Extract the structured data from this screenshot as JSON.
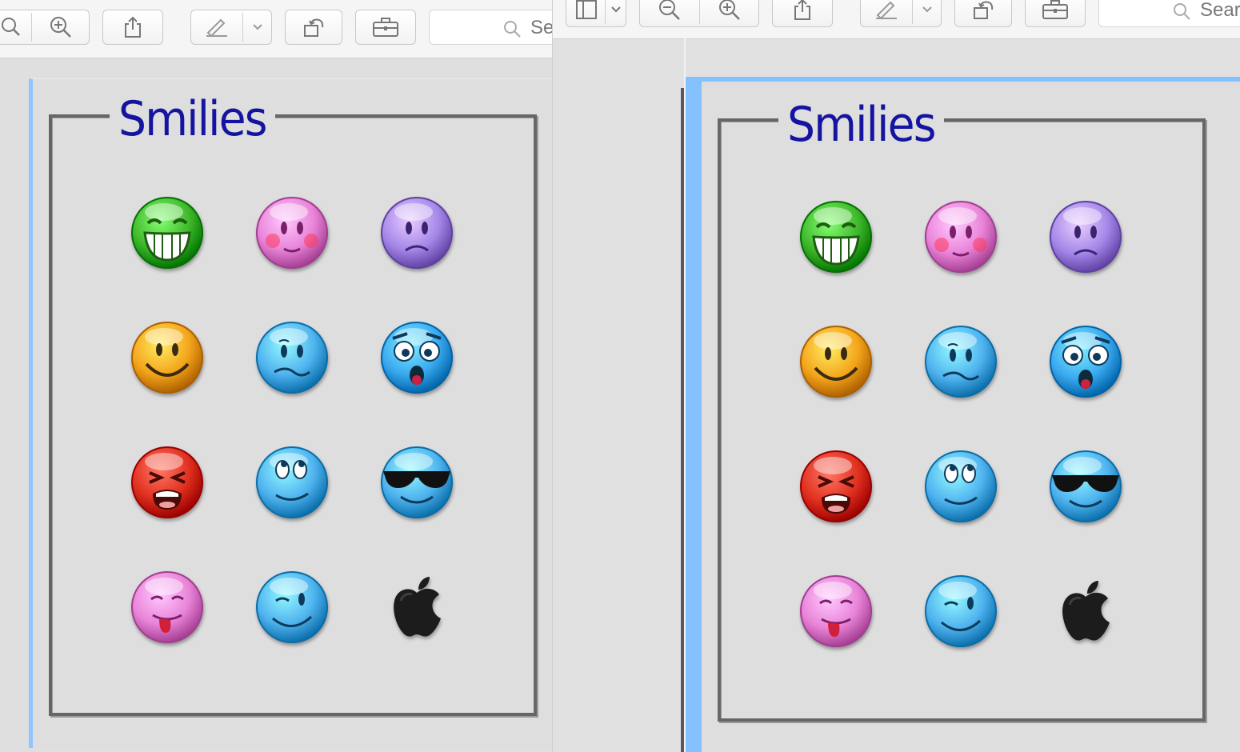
{
  "window_left": {
    "search_text": "Se",
    "frame_title": "Smilies"
  },
  "window_right": {
    "search_text": "Sear",
    "frame_title": "Smilies"
  },
  "toolbar_icons": [
    "sidebar-icon",
    "zoom-out-icon",
    "zoom-in-icon",
    "share-icon",
    "markup-pen-icon",
    "chevron-down-icon",
    "rotate-icon",
    "toolbox-icon",
    "search-icon"
  ],
  "smilies": [
    {
      "name": "grin",
      "color": "#3fb82b"
    },
    {
      "name": "blush",
      "color": "#e983d8"
    },
    {
      "name": "sad",
      "color": "#a487e8"
    },
    {
      "name": "smile",
      "color": "#f3a51b"
    },
    {
      "name": "confused",
      "color": "#4fb3ef"
    },
    {
      "name": "shocked",
      "color": "#3aa9ef"
    },
    {
      "name": "angry",
      "color": "#e0301f"
    },
    {
      "name": "rolleyes",
      "color": "#4fb3ef"
    },
    {
      "name": "cool",
      "color": "#4fb3ef"
    },
    {
      "name": "tongue",
      "color": "#e983d8"
    },
    {
      "name": "wink",
      "color": "#4fb3ef"
    },
    {
      "name": "apple",
      "color": "#222222"
    }
  ],
  "colors": {
    "title": "#1414a0",
    "selection": "#86c1ff",
    "frame": "#666666"
  }
}
